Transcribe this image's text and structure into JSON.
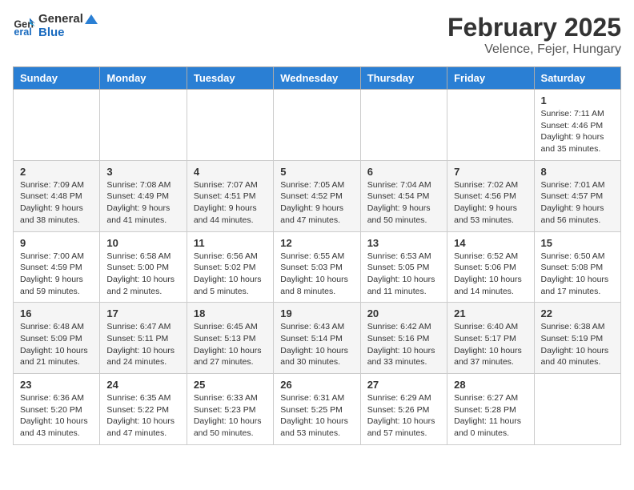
{
  "header": {
    "logo_line1": "General",
    "logo_line2": "Blue",
    "month": "February 2025",
    "location": "Velence, Fejer, Hungary"
  },
  "days_of_week": [
    "Sunday",
    "Monday",
    "Tuesday",
    "Wednesday",
    "Thursday",
    "Friday",
    "Saturday"
  ],
  "weeks": [
    [
      {
        "day": "",
        "info": ""
      },
      {
        "day": "",
        "info": ""
      },
      {
        "day": "",
        "info": ""
      },
      {
        "day": "",
        "info": ""
      },
      {
        "day": "",
        "info": ""
      },
      {
        "day": "",
        "info": ""
      },
      {
        "day": "1",
        "info": "Sunrise: 7:11 AM\nSunset: 4:46 PM\nDaylight: 9 hours and 35 minutes."
      }
    ],
    [
      {
        "day": "2",
        "info": "Sunrise: 7:09 AM\nSunset: 4:48 PM\nDaylight: 9 hours and 38 minutes."
      },
      {
        "day": "3",
        "info": "Sunrise: 7:08 AM\nSunset: 4:49 PM\nDaylight: 9 hours and 41 minutes."
      },
      {
        "day": "4",
        "info": "Sunrise: 7:07 AM\nSunset: 4:51 PM\nDaylight: 9 hours and 44 minutes."
      },
      {
        "day": "5",
        "info": "Sunrise: 7:05 AM\nSunset: 4:52 PM\nDaylight: 9 hours and 47 minutes."
      },
      {
        "day": "6",
        "info": "Sunrise: 7:04 AM\nSunset: 4:54 PM\nDaylight: 9 hours and 50 minutes."
      },
      {
        "day": "7",
        "info": "Sunrise: 7:02 AM\nSunset: 4:56 PM\nDaylight: 9 hours and 53 minutes."
      },
      {
        "day": "8",
        "info": "Sunrise: 7:01 AM\nSunset: 4:57 PM\nDaylight: 9 hours and 56 minutes."
      }
    ],
    [
      {
        "day": "9",
        "info": "Sunrise: 7:00 AM\nSunset: 4:59 PM\nDaylight: 9 hours and 59 minutes."
      },
      {
        "day": "10",
        "info": "Sunrise: 6:58 AM\nSunset: 5:00 PM\nDaylight: 10 hours and 2 minutes."
      },
      {
        "day": "11",
        "info": "Sunrise: 6:56 AM\nSunset: 5:02 PM\nDaylight: 10 hours and 5 minutes."
      },
      {
        "day": "12",
        "info": "Sunrise: 6:55 AM\nSunset: 5:03 PM\nDaylight: 10 hours and 8 minutes."
      },
      {
        "day": "13",
        "info": "Sunrise: 6:53 AM\nSunset: 5:05 PM\nDaylight: 10 hours and 11 minutes."
      },
      {
        "day": "14",
        "info": "Sunrise: 6:52 AM\nSunset: 5:06 PM\nDaylight: 10 hours and 14 minutes."
      },
      {
        "day": "15",
        "info": "Sunrise: 6:50 AM\nSunset: 5:08 PM\nDaylight: 10 hours and 17 minutes."
      }
    ],
    [
      {
        "day": "16",
        "info": "Sunrise: 6:48 AM\nSunset: 5:09 PM\nDaylight: 10 hours and 21 minutes."
      },
      {
        "day": "17",
        "info": "Sunrise: 6:47 AM\nSunset: 5:11 PM\nDaylight: 10 hours and 24 minutes."
      },
      {
        "day": "18",
        "info": "Sunrise: 6:45 AM\nSunset: 5:13 PM\nDaylight: 10 hours and 27 minutes."
      },
      {
        "day": "19",
        "info": "Sunrise: 6:43 AM\nSunset: 5:14 PM\nDaylight: 10 hours and 30 minutes."
      },
      {
        "day": "20",
        "info": "Sunrise: 6:42 AM\nSunset: 5:16 PM\nDaylight: 10 hours and 33 minutes."
      },
      {
        "day": "21",
        "info": "Sunrise: 6:40 AM\nSunset: 5:17 PM\nDaylight: 10 hours and 37 minutes."
      },
      {
        "day": "22",
        "info": "Sunrise: 6:38 AM\nSunset: 5:19 PM\nDaylight: 10 hours and 40 minutes."
      }
    ],
    [
      {
        "day": "23",
        "info": "Sunrise: 6:36 AM\nSunset: 5:20 PM\nDaylight: 10 hours and 43 minutes."
      },
      {
        "day": "24",
        "info": "Sunrise: 6:35 AM\nSunset: 5:22 PM\nDaylight: 10 hours and 47 minutes."
      },
      {
        "day": "25",
        "info": "Sunrise: 6:33 AM\nSunset: 5:23 PM\nDaylight: 10 hours and 50 minutes."
      },
      {
        "day": "26",
        "info": "Sunrise: 6:31 AM\nSunset: 5:25 PM\nDaylight: 10 hours and 53 minutes."
      },
      {
        "day": "27",
        "info": "Sunrise: 6:29 AM\nSunset: 5:26 PM\nDaylight: 10 hours and 57 minutes."
      },
      {
        "day": "28",
        "info": "Sunrise: 6:27 AM\nSunset: 5:28 PM\nDaylight: 11 hours and 0 minutes."
      },
      {
        "day": "",
        "info": ""
      }
    ]
  ]
}
